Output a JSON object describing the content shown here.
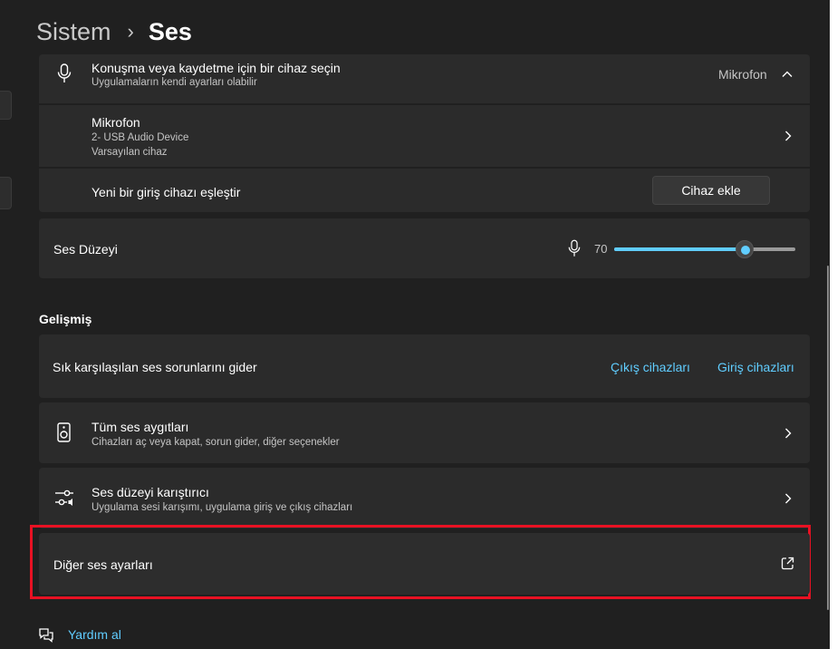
{
  "breadcrumb": {
    "parent": "Sistem",
    "current": "Ses"
  },
  "input_device_selector": {
    "title": "Konuşma veya kaydetme için bir cihaz seçin",
    "subtitle": "Uygulamaların kendi ayarları olabilir",
    "value": "Mikrofon",
    "icon": "microphone-icon"
  },
  "microphone_row": {
    "title": "Mikrofon",
    "line1": "2- USB Audio Device",
    "line2": "Varsayılan cihaz"
  },
  "pair_device_row": {
    "title": "Yeni bir giriş cihazı eşleştir",
    "button": "Cihaz ekle"
  },
  "volume_row": {
    "label": "Ses Düzeyi",
    "value": "70",
    "level": 0.7,
    "accent": "#60cdff"
  },
  "advanced": {
    "heading": "Gelişmiş",
    "troubleshoot": {
      "label": "Sık karşılaşılan ses sorunlarını gider",
      "link_output": "Çıkış cihazları",
      "link_input": "Giriş cihazları"
    },
    "all_devices": {
      "title": "Tüm ses aygıtları",
      "subtitle": "Cihazları aç veya kapat, sorun gider, diğer seçenekler",
      "icon": "speaker-icon"
    },
    "mixer": {
      "title": "Ses düzeyi karıştırıcı",
      "subtitle": "Uygulama sesi karışımı, uygulama giriş ve çıkış cihazları",
      "icon": "mixer-icon"
    },
    "more_settings": {
      "label": "Diğer ses ayarları",
      "icon": "external-link-icon",
      "highlight_color": "#e81123"
    }
  },
  "help": {
    "label": "Yardım al",
    "icon": "help-chat-icon"
  }
}
